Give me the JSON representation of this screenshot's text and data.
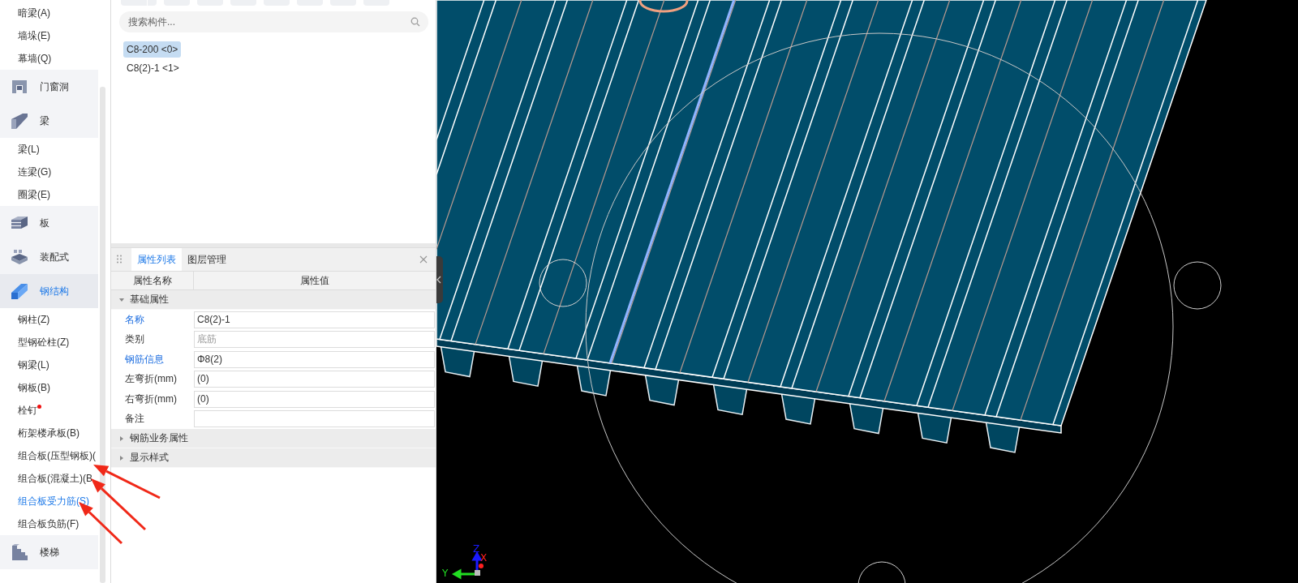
{
  "sidebar": {
    "items": [
      {
        "kind": "item",
        "label": "暗梁(A)",
        "selected": false,
        "dot": false
      },
      {
        "kind": "item",
        "label": "墙垛(E)",
        "selected": false,
        "dot": false
      },
      {
        "kind": "item",
        "label": "幕墙(Q)",
        "selected": false,
        "dot": false
      },
      {
        "kind": "group",
        "label": "门窗洞",
        "selected": false
      },
      {
        "kind": "group",
        "label": "梁",
        "selected": false
      },
      {
        "kind": "item",
        "label": "梁(L)",
        "selected": false,
        "dot": false
      },
      {
        "kind": "item",
        "label": "连梁(G)",
        "selected": false,
        "dot": false
      },
      {
        "kind": "item",
        "label": "圈梁(E)",
        "selected": false,
        "dot": false
      },
      {
        "kind": "group",
        "label": "板",
        "selected": false
      },
      {
        "kind": "group",
        "label": "装配式",
        "selected": false
      },
      {
        "kind": "group",
        "label": "钢结构",
        "selected": true
      },
      {
        "kind": "item",
        "label": "钢柱(Z)",
        "selected": false,
        "dot": false
      },
      {
        "kind": "item",
        "label": "型钢砼柱(Z)",
        "selected": false,
        "dot": false
      },
      {
        "kind": "item",
        "label": "钢梁(L)",
        "selected": false,
        "dot": false
      },
      {
        "kind": "item",
        "label": "钢板(B)",
        "selected": false,
        "dot": false
      },
      {
        "kind": "item",
        "label": "栓钉",
        "selected": false,
        "dot": true
      },
      {
        "kind": "item",
        "label": "桁架楼承板(B)",
        "selected": false,
        "dot": false
      },
      {
        "kind": "item",
        "label": "组合板(压型钢板)(",
        "selected": false,
        "dot": false
      },
      {
        "kind": "item",
        "label": "组合板(混凝土)(B",
        "selected": false,
        "dot": false
      },
      {
        "kind": "item",
        "label": "组合板受力筋(S)",
        "selected": true,
        "dot": false
      },
      {
        "kind": "item",
        "label": "组合板负筋(F)",
        "selected": false,
        "dot": false
      },
      {
        "kind": "group",
        "label": "楼梯",
        "selected": false
      }
    ]
  },
  "toolbar": {
    "buttons": [
      {
        "split": true
      },
      {
        "split": false
      },
      {
        "split": false
      },
      {
        "split": false
      },
      {
        "split": false
      },
      {
        "split": false
      },
      {
        "split": false
      },
      {
        "split": false
      }
    ]
  },
  "search": {
    "placeholder": "搜索构件..."
  },
  "components": [
    {
      "label": "C8-200 <0>",
      "selected": true
    },
    {
      "label": "C8(2)-1 <1>",
      "selected": false
    }
  ],
  "properties": {
    "tabs": [
      {
        "label": "属性列表",
        "selected": true
      },
      {
        "label": "图层管理",
        "selected": false
      }
    ],
    "columns": [
      "属性名称",
      "属性值"
    ],
    "groups": [
      {
        "label": "基础属性",
        "expanded": true,
        "rows": [
          {
            "name": "名称",
            "value": "C8(2)-1",
            "highlight": true,
            "disabled": false
          },
          {
            "name": "类别",
            "value": "底筋",
            "highlight": false,
            "disabled": true
          },
          {
            "name": "钢筋信息",
            "value": "Φ8(2)",
            "highlight": true,
            "disabled": false
          },
          {
            "name": "左弯折(mm)",
            "value": "(0)",
            "highlight": false,
            "disabled": false
          },
          {
            "name": "右弯折(mm)",
            "value": "(0)",
            "highlight": false,
            "disabled": false
          },
          {
            "name": "备注",
            "highlight": false,
            "disabled": false
          }
        ]
      },
      {
        "label": "钢筋业务属性",
        "expanded": false
      },
      {
        "label": "显示样式",
        "expanded": false
      }
    ]
  },
  "viewport": {
    "axes": [
      {
        "label": "Z",
        "color": "#1a1aff"
      },
      {
        "label": "X",
        "color": "#ff2020"
      },
      {
        "label": "Y",
        "color": "#22dd22"
      }
    ]
  }
}
